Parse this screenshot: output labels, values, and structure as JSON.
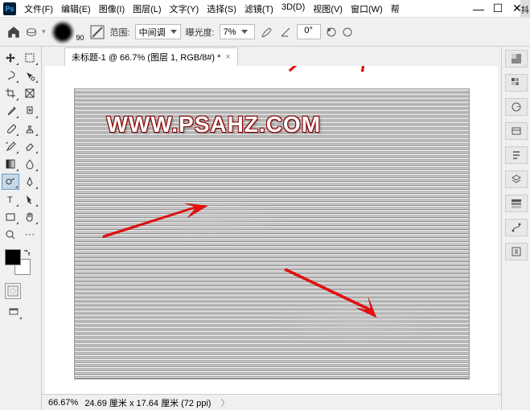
{
  "ps_logo": "Ps",
  "menu": [
    "文件(F)",
    "编辑(E)",
    "图像(I)",
    "图层(L)",
    "文字(Y)",
    "选择(S)",
    "滤镜(T)",
    "3D(D)",
    "视图(V)",
    "窗口(W)",
    "帮"
  ],
  "brush_size": "90",
  "options": {
    "range_label": "范围:",
    "range_value": "中间调",
    "exposure_label": "曝光度:",
    "exposure_value": "7%",
    "angle_value": "0°"
  },
  "tab": {
    "title": "未标题-1 @ 66.7% (图层 1, RGB/8#) *"
  },
  "watermark": "WWW.PSAHZ.COM",
  "status": {
    "zoom": "66.67%",
    "dims": "24.69 厘米 x 17.64 厘米 (72 ppi)"
  },
  "side_tab": "抖"
}
